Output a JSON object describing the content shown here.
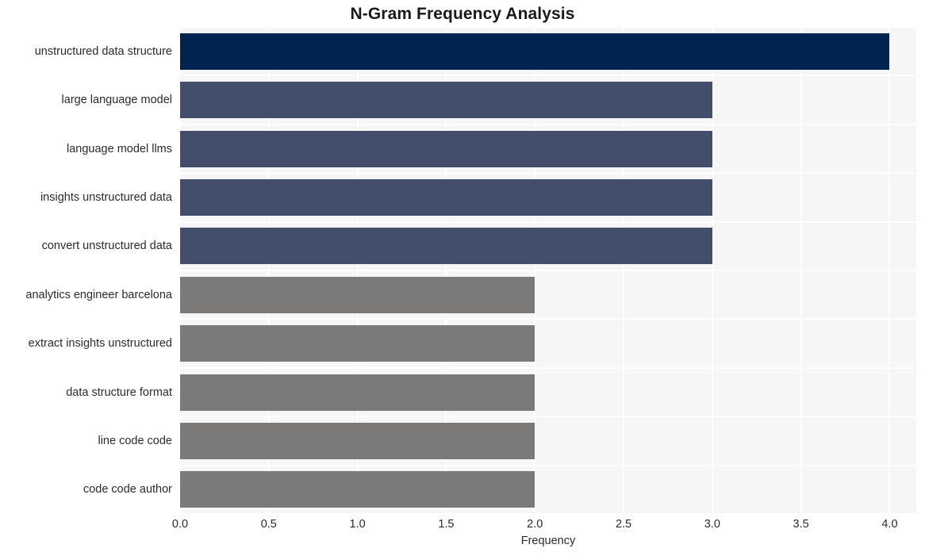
{
  "chart_data": {
    "type": "bar",
    "orientation": "horizontal",
    "title": "N-Gram Frequency Analysis",
    "xlabel": "Frequency",
    "ylabel": "",
    "xlim": [
      0,
      4.15
    ],
    "xticks": [
      "0.0",
      "0.5",
      "1.0",
      "1.5",
      "2.0",
      "2.5",
      "3.0",
      "3.5",
      "4.0"
    ],
    "xtick_values": [
      0.0,
      0.5,
      1.0,
      1.5,
      2.0,
      2.5,
      3.0,
      3.5,
      4.0
    ],
    "grid": true,
    "legend": "none",
    "categories": [
      "unstructured data structure",
      "large language model",
      "language model llms",
      "insights unstructured data",
      "convert unstructured data",
      "analytics engineer barcelona",
      "extract insights unstructured",
      "data structure format",
      "line code code",
      "code code author"
    ],
    "values": [
      4,
      3,
      3,
      3,
      3,
      2,
      2,
      2,
      2,
      2
    ],
    "bar_colors": [
      "#012451",
      "#434e6d",
      "#434e6d",
      "#434e6d",
      "#434e6d",
      "#7b7a78",
      "#7b7a78",
      "#7b7a78",
      "#7b7a78",
      "#7b7a78"
    ]
  },
  "style": {
    "plot_background": "#f6f6f7",
    "grid_color": "#ffffff",
    "page_background": "#ffffff",
    "text_color": "#2b2b2b",
    "title_color": "#1a1a1a"
  }
}
